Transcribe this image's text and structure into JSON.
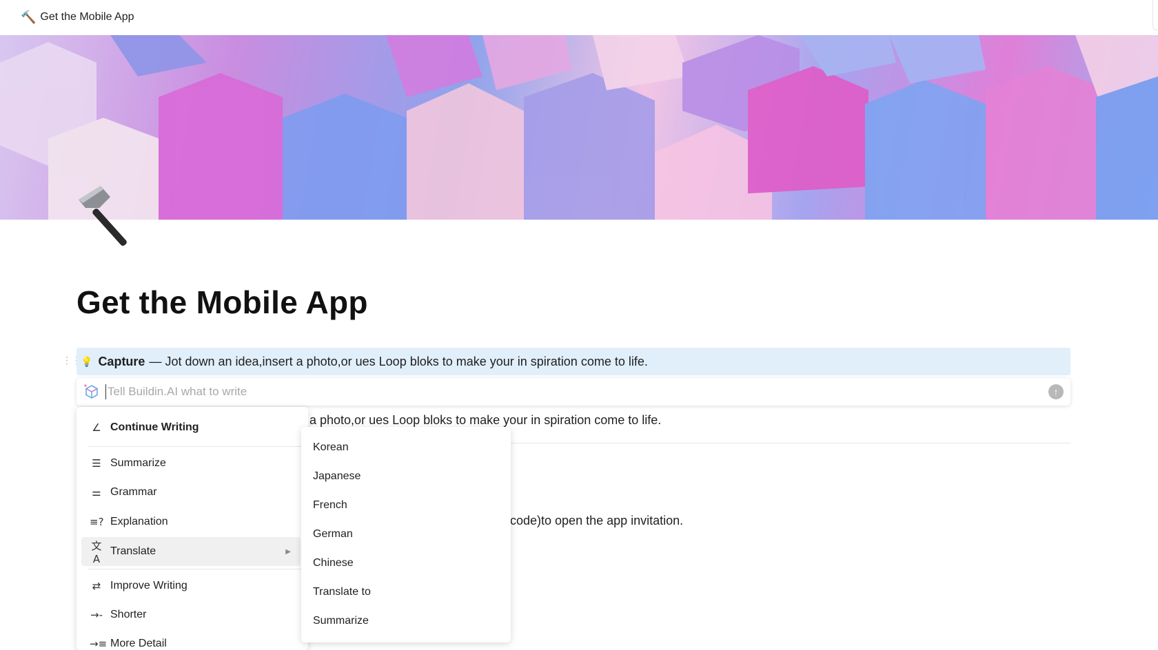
{
  "header": {
    "icon": "hammer-icon",
    "title": "Get the Mobile App"
  },
  "page": {
    "icon": "hammer-icon",
    "title": "Get the Mobile App",
    "callout": {
      "icon": "lightbulb-icon",
      "bold": "Capture",
      "text": "— Jot down an idea,insert a photo,or ues Loop bloks to make your in spiration come to life."
    },
    "bg_line_1": "a photo,or ues Loop bloks to make your in spiration come to life.",
    "bg_line_2": "code)to open the app invitation."
  },
  "ai_bar": {
    "placeholder": "Tell Buildin.AI what to write",
    "icon": "ai-cube-icon",
    "send_icon": "arrow-up-icon"
  },
  "menu": {
    "items": [
      {
        "label": "Continue Writing",
        "icon": "pen-icon"
      },
      {
        "label": "Summarize",
        "icon": "summarize-icon"
      },
      {
        "label": "Grammar",
        "icon": "grammar-icon"
      },
      {
        "label": "Explanation",
        "icon": "explanation-icon"
      },
      {
        "label": "Translate",
        "icon": "translate-icon",
        "active": true
      },
      {
        "label": "Improve Writing",
        "icon": "swap-icon"
      },
      {
        "label": "Shorter",
        "icon": "shorter-icon"
      },
      {
        "label": "More Detail",
        "icon": "more-detail-icon"
      }
    ]
  },
  "submenu": {
    "items": [
      "Korean",
      "Japanese",
      "French",
      "German",
      "Chinese",
      "Translate to",
      "Summarize"
    ]
  },
  "colors": {
    "callout_bg": "#e1effb",
    "active_item": "#f0f0f0"
  }
}
